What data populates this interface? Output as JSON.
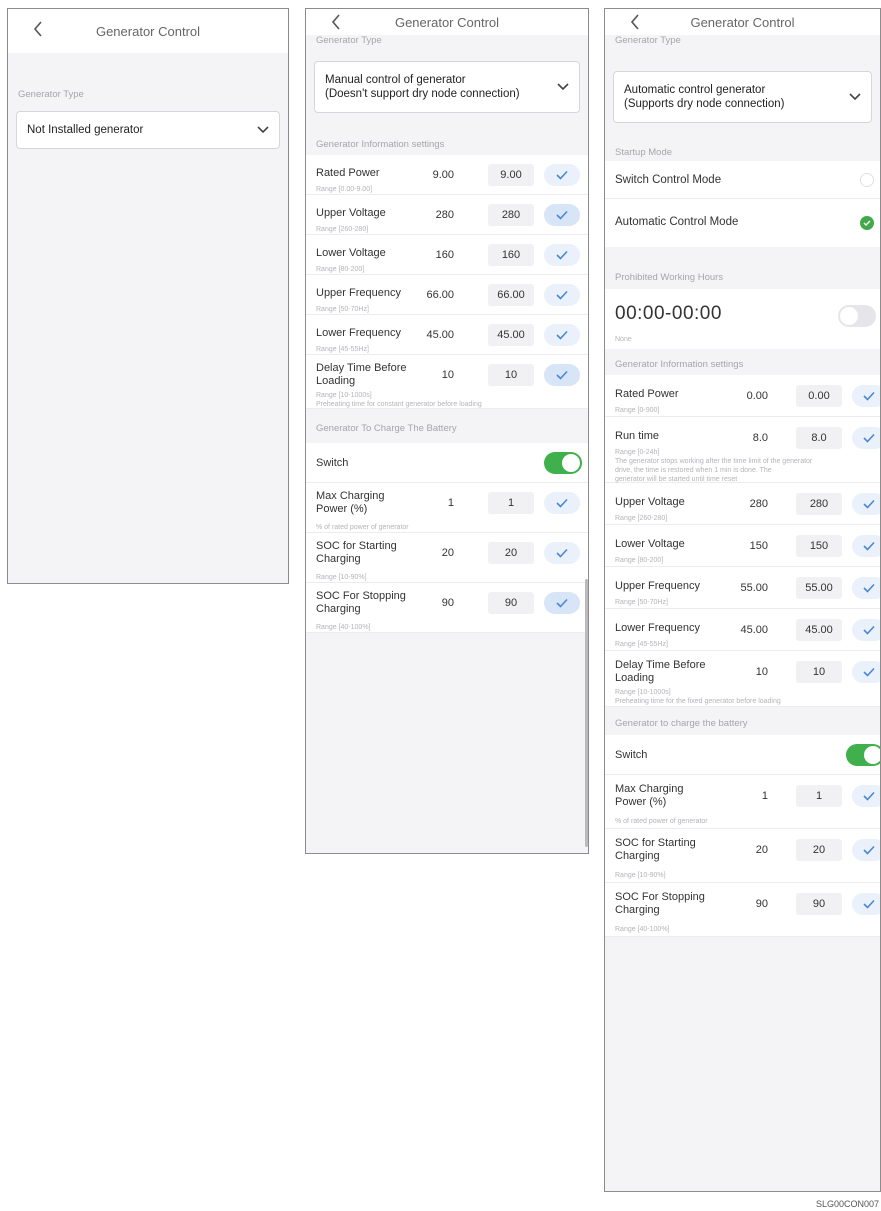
{
  "screen1": {
    "title": "Generator Control",
    "section_label": "Generator Type",
    "type_value": "Not Installed generator"
  },
  "screen2": {
    "title": "Generator Control",
    "section_type": "Generator Type",
    "type_value": "Manual control of generator\n(Doesn't support dry node connection)",
    "section_info": "Generator Information settings",
    "rows": [
      {
        "label": "Rated Power",
        "current": "9.00",
        "input": "9.00",
        "hint": "Range [0.00-9.00]",
        "active": false
      },
      {
        "label": "Upper Voltage",
        "current": "280",
        "input": "280",
        "hint": "Range [260-280]",
        "active": true
      },
      {
        "label": "Lower Voltage",
        "current": "160",
        "input": "160",
        "hint": "Range [80-200]",
        "active": false
      },
      {
        "label": "Upper Frequency",
        "current": "66.00",
        "input": "66.00",
        "hint": "Range [50-70Hz]",
        "active": false
      },
      {
        "label": "Lower Frequency",
        "current": "45.00",
        "input": "45.00",
        "hint": "Range [45-55Hz]",
        "active": false
      },
      {
        "label": "Delay Time Before\nLoading",
        "current": "10",
        "input": "10",
        "hint": "Range [10-1000s]\nPreheating time for constant generator before loading",
        "active": true
      }
    ],
    "section_charge": "Generator To Charge The Battery",
    "switch_label": "Switch",
    "charge_rows": [
      {
        "label": "Max Charging\nPower (%)",
        "current": "1",
        "input": "1",
        "hint": "% of rated power of generator",
        "active": false
      },
      {
        "label": "SOC for Starting\nCharging",
        "current": "20",
        "input": "20",
        "hint": "Range [10-90%]",
        "active": false
      },
      {
        "label": "SOC For Stopping\nCharging",
        "current": "90",
        "input": "90",
        "hint": "Range [40-100%]",
        "active": true
      }
    ]
  },
  "screen3": {
    "title": "Generator Control",
    "section_type": "Generator Type",
    "type_value": "Automatic control generator\n(Supports dry node connection)",
    "section_startup": "Startup Mode",
    "mode_switch": "Switch Control Mode",
    "mode_auto": "Automatic Control Mode",
    "section_forbidden": "Prohibited Working Hours",
    "forbidden_time": "00:00-00:00",
    "forbidden_hint": "None",
    "section_info": "Generator Information settings",
    "rows": [
      {
        "label": "Rated Power",
        "current": "0.00",
        "input": "0.00",
        "hint": "Range [0-900]"
      },
      {
        "label": "Run time",
        "current": "8.0",
        "input": "8.0",
        "hint": "Range [0-24h]\nThe generator stops working after the time limit of the generator\ndrive, the time is restored when 1 min is done. The\ngenerator will be started until time reset"
      },
      {
        "label": "Upper Voltage",
        "current": "280",
        "input": "280",
        "hint": "Range [260-280]"
      },
      {
        "label": "Lower Voltage",
        "current": "150",
        "input": "150",
        "hint": "Range [80-200]"
      },
      {
        "label": "Upper Frequency",
        "current": "55.00",
        "input": "55.00",
        "hint": "Range [50-70Hz]"
      },
      {
        "label": "Lower Frequency",
        "current": "45.00",
        "input": "45.00",
        "hint": "Range [45-55Hz]"
      },
      {
        "label": "Delay Time Before\nLoading",
        "current": "10",
        "input": "10",
        "hint": "Range [10-1000s]\nPreheating time for the fixed generator before loading"
      }
    ],
    "section_charge": "Generator to charge the battery",
    "switch_label": "Switch",
    "charge_rows": [
      {
        "label": "Max Charging\nPower (%)",
        "current": "1",
        "input": "1",
        "hint": "% of rated power of generator"
      },
      {
        "label": "SOC for Starting\nCharging",
        "current": "20",
        "input": "20",
        "hint": "Range [10-90%]"
      },
      {
        "label": "SOC For Stopping\nCharging",
        "current": "90",
        "input": "90",
        "hint": "Range [40-100%]"
      }
    ]
  },
  "figure_code": "SLG00CON007",
  "colors": {
    "toggle_on": "#3fb04b",
    "confirm_bg": "#d7e5f7",
    "confirm_check": "#4a86d6"
  },
  "icons": {
    "back": "chevron-left-icon",
    "dropdown": "chevron-down-icon",
    "confirm": "check-icon"
  }
}
